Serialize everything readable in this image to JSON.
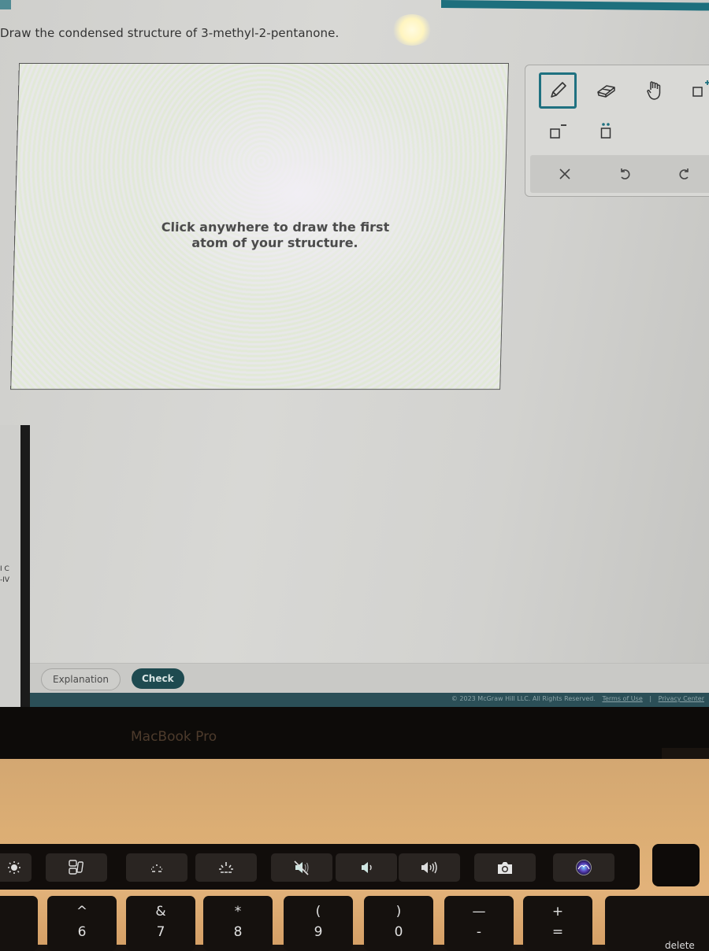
{
  "question": {
    "prompt": "Draw the condensed structure of 3-methyl-2-pentanone."
  },
  "canvas": {
    "hint_line1": "Click anywhere to draw the first",
    "hint_line2": "atom of your structure."
  },
  "toolbox": {
    "tools": [
      {
        "name": "pencil",
        "icon": "pencil-icon",
        "active": true
      },
      {
        "name": "eraser",
        "icon": "eraser-icon",
        "active": false
      },
      {
        "name": "hand",
        "icon": "hand-icon",
        "active": false
      },
      {
        "name": "positive-charge",
        "icon": "positive-charge-icon",
        "label": "+",
        "active": false
      },
      {
        "name": "negative-charge",
        "icon": "negative-charge-icon",
        "label": "−",
        "active": false
      },
      {
        "name": "lone-pair",
        "icon": "lone-pair-icon",
        "label": "••",
        "active": false
      }
    ],
    "actions": [
      {
        "name": "clear",
        "icon": "close-icon",
        "label": "×"
      },
      {
        "name": "undo",
        "icon": "undo-icon"
      },
      {
        "name": "redo",
        "icon": "redo-icon"
      }
    ],
    "accent_color": "#1f7180"
  },
  "actions": {
    "explanation_label": "Explanation",
    "check_label": "Check"
  },
  "footer": {
    "copyright": "© 2023 McGraw Hill LLC. All Rights Reserved.",
    "terms_label": "Terms of Use",
    "separator": "|",
    "privacy_label": "Privacy Center"
  },
  "side_fragment": {
    "line1": "I C",
    "line2": "-IV"
  },
  "laptop": {
    "brand": "MacBook Pro",
    "touch_bar": [
      {
        "name": "brightness",
        "icon": "brightness-icon"
      },
      {
        "name": "mission-control",
        "icon": "mission-control-icon"
      },
      {
        "name": "keyboard-brightness-down",
        "icon": "keyboard-brightness-down-icon"
      },
      {
        "name": "keyboard-brightness-up",
        "icon": "keyboard-brightness-up-icon"
      },
      {
        "name": "mute",
        "icon": "mute-icon"
      },
      {
        "name": "volume-down",
        "icon": "volume-down-icon"
      },
      {
        "name": "volume-up",
        "icon": "volume-up-icon"
      },
      {
        "name": "screenshot",
        "icon": "camera-icon"
      },
      {
        "name": "siri",
        "icon": "siri-icon"
      }
    ],
    "keys": [
      {
        "top": "^",
        "bottom": "6"
      },
      {
        "top": "&",
        "bottom": "7"
      },
      {
        "top": "*",
        "bottom": "8"
      },
      {
        "top": "(",
        "bottom": "9"
      },
      {
        "top": ")",
        "bottom": "0"
      },
      {
        "top": "—",
        "bottom": "-"
      },
      {
        "top": "+",
        "bottom": "="
      }
    ],
    "delete_label": "delete"
  }
}
